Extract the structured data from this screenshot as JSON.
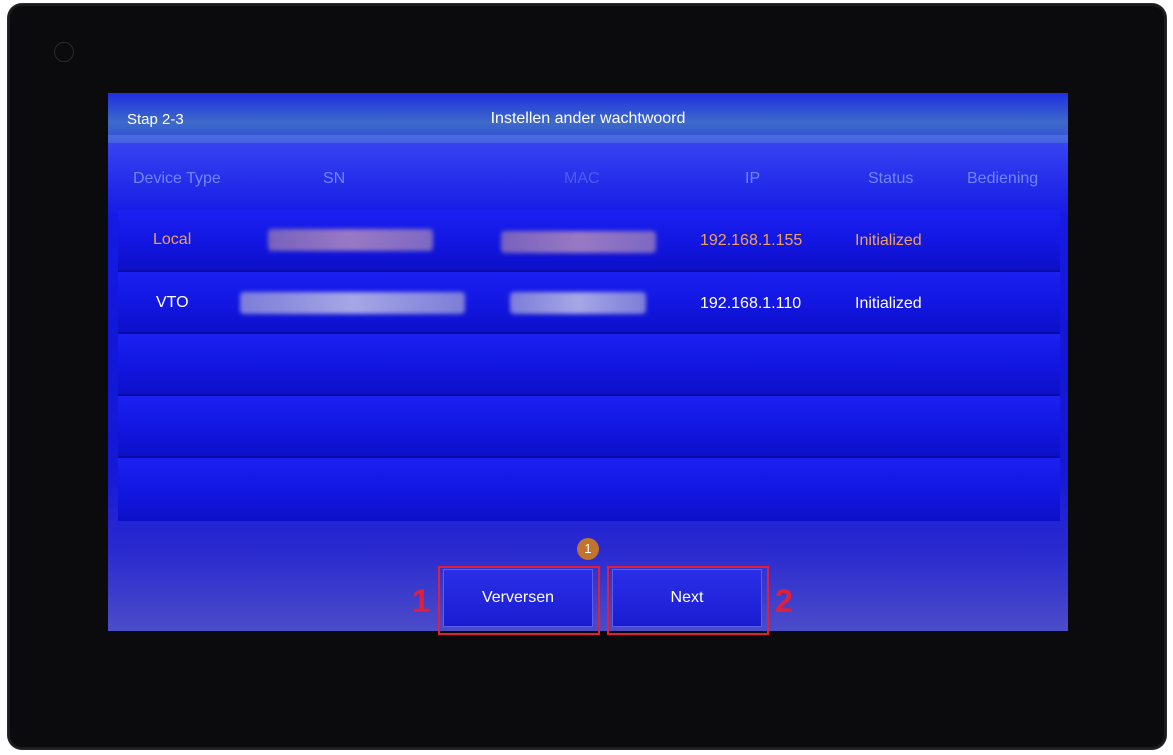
{
  "header": {
    "step": "Stap 2-3",
    "title": "Instellen ander wachtwoord"
  },
  "table": {
    "columns": [
      "Device Type",
      "SN",
      "MAC",
      "IP",
      "Status",
      "Bediening"
    ],
    "rows": [
      {
        "device_type": "Local",
        "ip": "192.168.1.155",
        "status": "Initialized",
        "text_color": "#f0a060"
      },
      {
        "device_type": "VTO",
        "ip": "192.168.1.110",
        "status": "Initialized",
        "text_color": "#ffffff"
      }
    ]
  },
  "notification_badge": "1",
  "buttons": {
    "refresh": "Verversen",
    "next": "Next"
  },
  "annotations": {
    "marker_1": "1",
    "marker_2": "2",
    "color": "#e0203a"
  },
  "colors": {
    "screen_bg": "#1a1ff0",
    "header_text": "#6f86ff",
    "local_text": "#f0a060"
  }
}
